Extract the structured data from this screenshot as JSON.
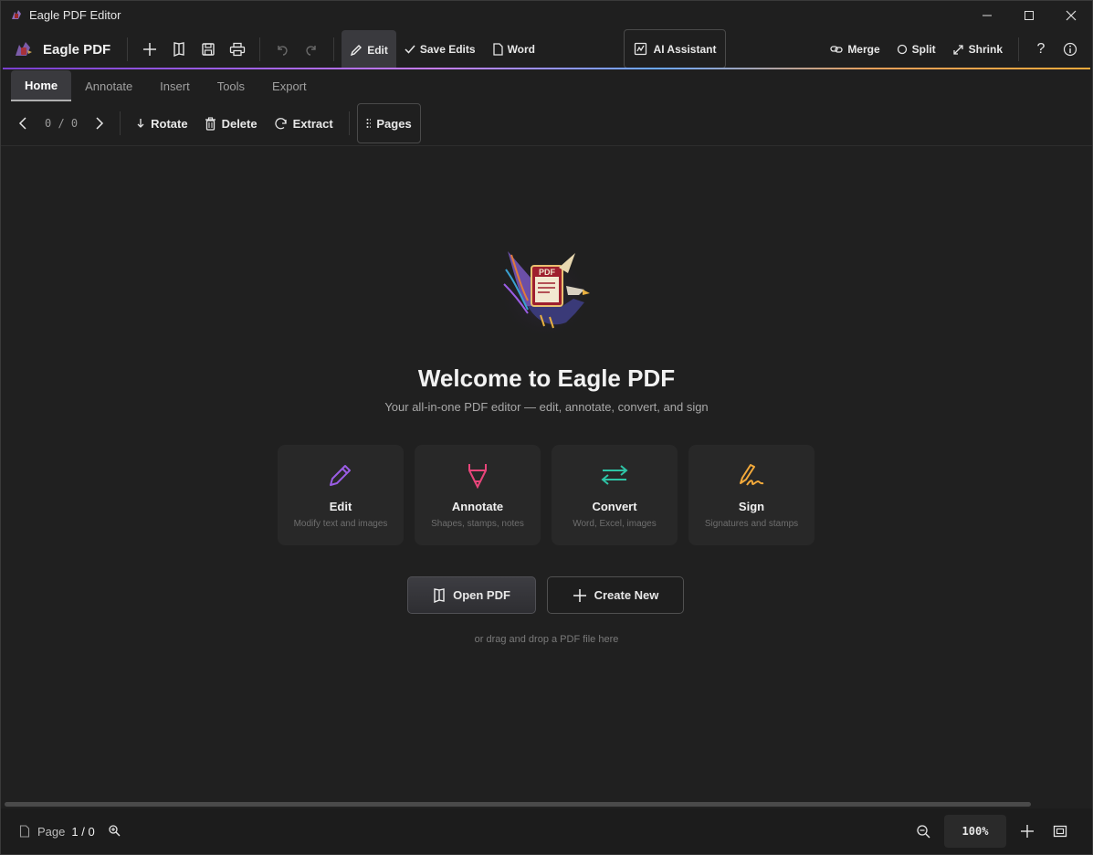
{
  "window": {
    "title": "Eagle PDF Editor"
  },
  "toolbar": {
    "brand": "Eagle PDF",
    "edit_label": "Edit",
    "save_edits_label": "Save Edits",
    "word_label": "Word",
    "ai_label": "AI Assistant",
    "merge_label": "Merge",
    "split_label": "Split",
    "shrink_label": "Shrink"
  },
  "tabs": [
    "Home",
    "Annotate",
    "Insert",
    "Tools",
    "Export"
  ],
  "ribbon": {
    "page_counter": "0 / 0",
    "rotate_label": "Rotate",
    "delete_label": "Delete",
    "extract_label": "Extract",
    "pages_label": "Pages"
  },
  "welcome": {
    "title": "Welcome to Eagle PDF",
    "subtitle": "Your all-in-one PDF editor — edit, annotate, convert, and sign",
    "cards": [
      {
        "title": "Edit",
        "desc": "Modify text and images",
        "color": "#9b5de5"
      },
      {
        "title": "Annotate",
        "desc": "Shapes, stamps, notes",
        "color": "#e8457a"
      },
      {
        "title": "Convert",
        "desc": "Word, Excel, images",
        "color": "#2ec4a6"
      },
      {
        "title": "Sign",
        "desc": "Signatures and stamps",
        "color": "#f2a93b"
      }
    ],
    "open_label": "Open PDF",
    "create_label": "Create New",
    "drop_hint": "or drag and drop a PDF file here"
  },
  "status": {
    "page_label": "Page",
    "page_value": "1 / 0",
    "zoom": "100%"
  }
}
